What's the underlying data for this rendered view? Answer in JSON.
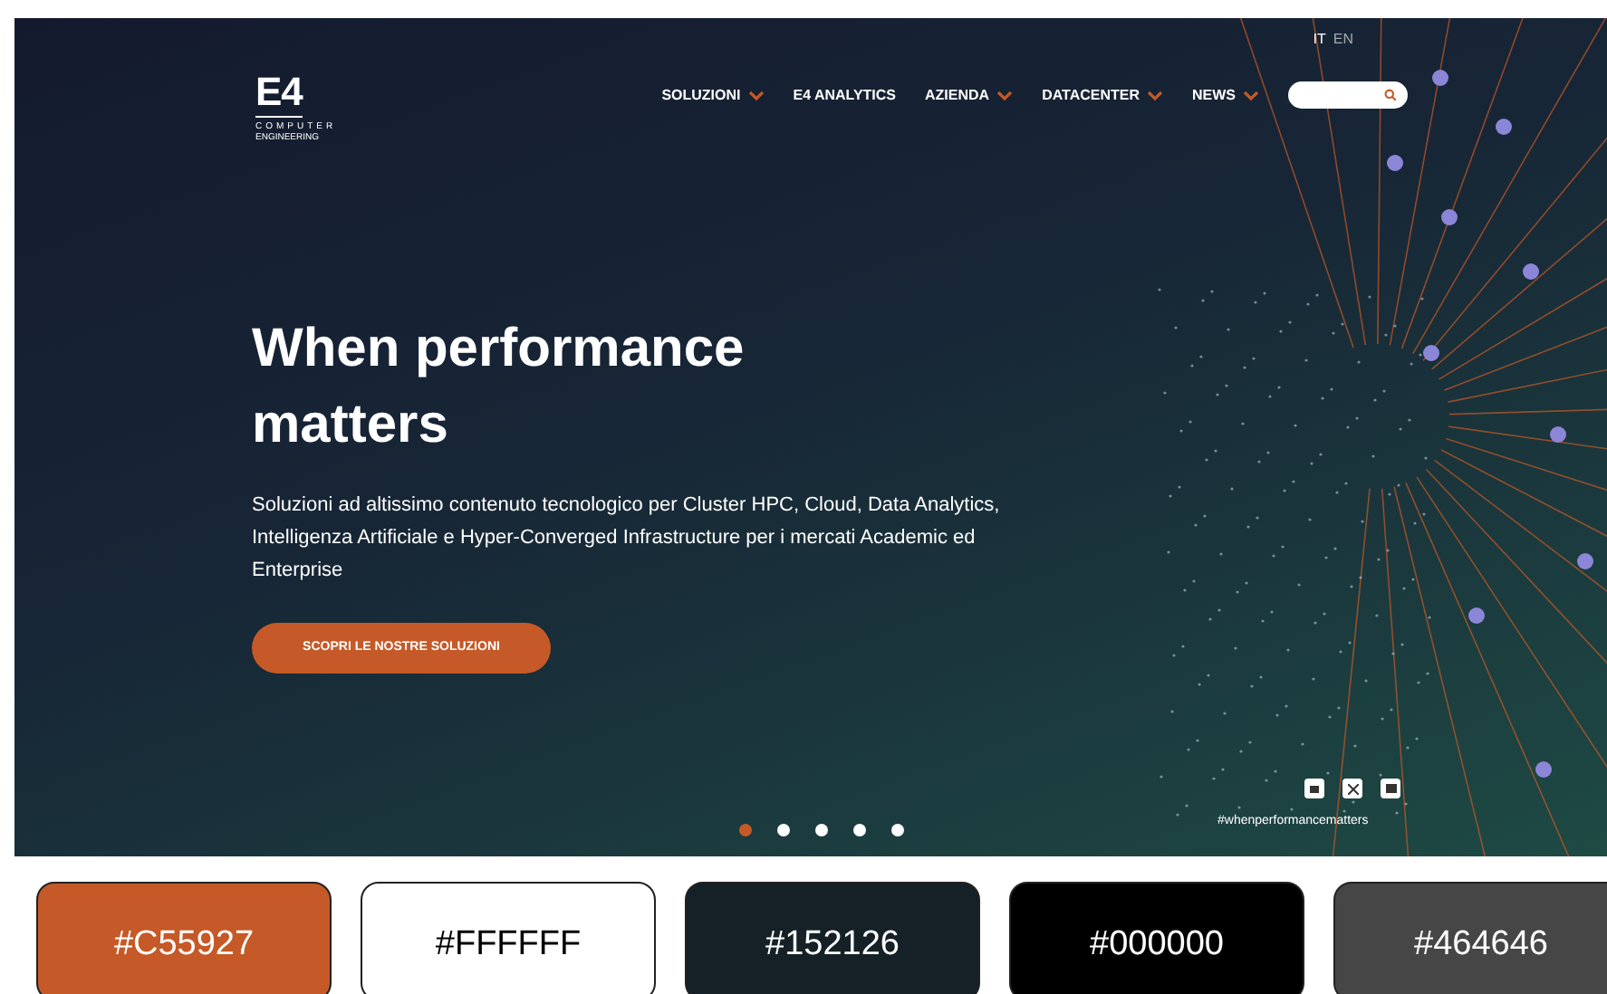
{
  "logo": {
    "mark": "E4",
    "line_1": "COMPUTER",
    "line_2": "ENGINEERING"
  },
  "languages": [
    {
      "label": "IT",
      "selected": true
    },
    {
      "label": "EN",
      "selected": false
    }
  ],
  "nav": [
    {
      "label": "SOLUZIONI",
      "dropdown": true
    },
    {
      "label": "E4 ANALYTICS",
      "dropdown": false
    },
    {
      "label": "AZIENDA",
      "dropdown": true
    },
    {
      "label": "DATACENTER",
      "dropdown": true
    },
    {
      "label": "NEWS",
      "dropdown": true
    }
  ],
  "hero": {
    "headline": "When performance matters",
    "text": "Soluzioni ad altissimo contenuto tecnologico per Cluster HPC, Cloud, Data Analytics, Intelligenza Artificiale e Hyper-Converged Infrastructure per i mercati Academic ed Enterprise",
    "button": "SCOPRI LE NOSTRE SOLUZIONI"
  },
  "slides": [
    {
      "selected": true
    },
    {
      "selected": false
    },
    {
      "selected": false
    },
    {
      "selected": false
    },
    {
      "selected": false
    }
  ],
  "hashtag": "#whenperformancematters",
  "swatches": [
    {
      "label": "#C55927",
      "color": "#c55927"
    },
    {
      "label": "#FFFFFF",
      "color": "#ffffff"
    },
    {
      "label": "#152126",
      "color": "#152126"
    },
    {
      "label": "#000000",
      "color": "#000000"
    },
    {
      "label": "#464646",
      "color": "#464646"
    }
  ]
}
